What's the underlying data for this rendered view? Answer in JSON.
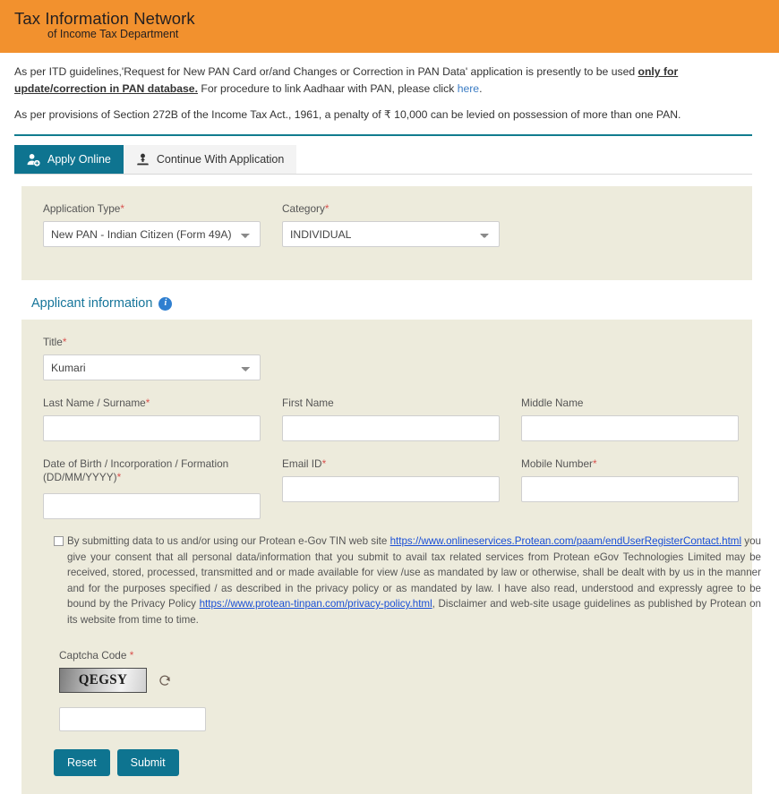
{
  "header": {
    "brand_line1": "Tax Information Network",
    "brand_line2": "of Income Tax Department"
  },
  "notices": {
    "first_part1": "As per ITD guidelines,'Request for New PAN Card or/and Changes or Correction in PAN Data' application is presently to be used ",
    "first_emphasis": "only for update/correction in PAN database.",
    "first_part2": " For procedure to link Aadhaar with PAN, please click ",
    "first_link": "here",
    "first_part3": ".",
    "second": "As per provisions of Section 272B of the Income Tax Act., 1961, a penalty of ₹ 10,000 can be levied on possession of more than one PAN."
  },
  "tabs": [
    {
      "label": "Apply Online",
      "icon": "user-add-icon",
      "active": true
    },
    {
      "label": "Continue With Application",
      "icon": "user-upload-icon",
      "active": false
    }
  ],
  "application": {
    "type_label": "Application Type",
    "type_value": "New PAN - Indian Citizen (Form 49A)",
    "category_label": "Category",
    "category_value": "INDIVIDUAL"
  },
  "applicant": {
    "section_title": "Applicant information",
    "title_label": "Title",
    "title_value": "Kumari",
    "last_name_label": "Last Name / Surname",
    "last_name_value": "",
    "first_name_label": "First Name",
    "first_name_value": "",
    "middle_name_label": "Middle Name",
    "middle_name_value": "",
    "dob_label": "Date of Birth / Incorporation / Formation (DD/MM/YYYY)",
    "dob_value": "",
    "email_label": "Email ID",
    "email_value": "",
    "mobile_label": "Mobile Number",
    "mobile_value": ""
  },
  "consent": {
    "p1": "By submitting data to us and/or using our Protean e-Gov TIN web site ",
    "link1": "https://www.onlineservices.Protean.com/paam/endUserRegisterContact.html",
    "p2": " you give your consent that all personal data/information that you submit to avail tax related services from Protean eGov Technologies Limited may be received, stored, processed, transmitted and or made available for view /use as mandated by law or otherwise, shall be dealt with by us in the manner and for the purposes specified / as described in the privacy policy or as mandated by law. I have also read, understood and expressly agree to be bound by the Privacy Policy ",
    "link2": "https://www.protean-tinpan.com/privacy-policy.html",
    "p3": ", Disclaimer and web-site usage guidelines as published by Protean on its website from time to time."
  },
  "captcha": {
    "label": "Captcha Code",
    "code_text": "QEGSY",
    "refresh_icon": "refresh-icon",
    "input_value": "",
    "input_placeholder": ""
  },
  "buttons": {
    "reset": "Reset",
    "submit": "Submit"
  },
  "colors": {
    "header_orange": "#F2912E",
    "teal": "#0e7490",
    "panel_beige": "#EDEBDC",
    "link_blue": "#1a4fd6",
    "section_heading": "#16759A",
    "required_red": "#d9534f"
  }
}
